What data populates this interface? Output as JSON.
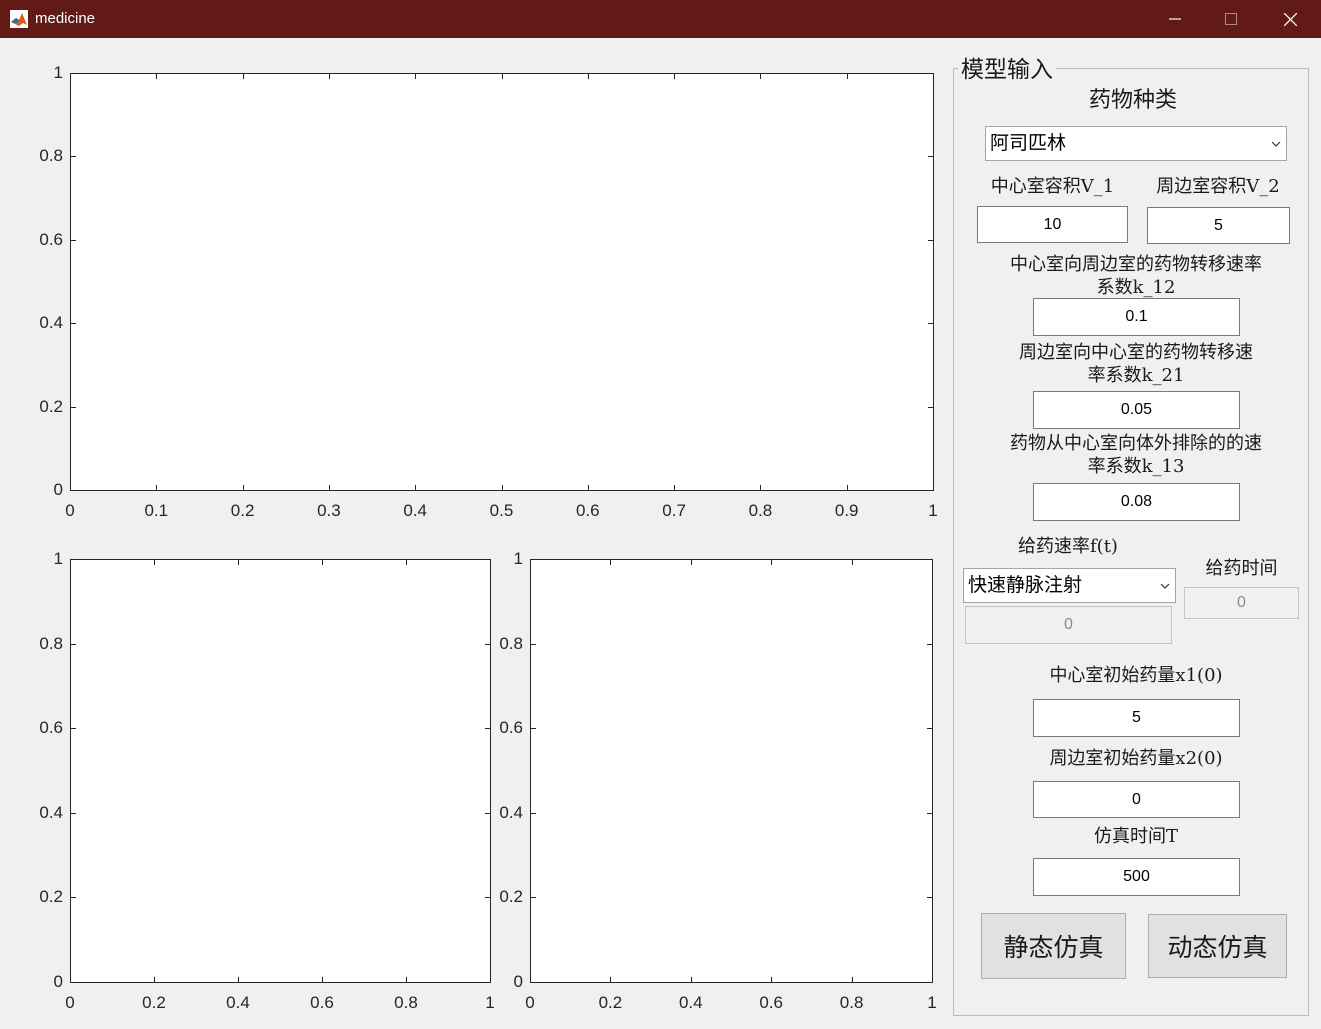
{
  "window": {
    "title": "medicine"
  },
  "plots": {
    "top": {
      "x_ticks": [
        "0",
        "0.1",
        "0.2",
        "0.3",
        "0.4",
        "0.5",
        "0.6",
        "0.7",
        "0.8",
        "0.9",
        "1"
      ],
      "y_ticks": [
        "0",
        "0.2",
        "0.4",
        "0.6",
        "0.8",
        "1"
      ]
    },
    "bottom_left": {
      "x_ticks": [
        "0",
        "0.2",
        "0.4",
        "0.6",
        "0.8",
        "1"
      ],
      "y_ticks": [
        "0",
        "0.2",
        "0.4",
        "0.6",
        "0.8",
        "1"
      ]
    },
    "bottom_right": {
      "x_ticks": [
        "0",
        "0.2",
        "0.4",
        "0.6",
        "0.8",
        "1"
      ],
      "y_ticks": [
        "0",
        "0.2",
        "0.4",
        "0.6",
        "0.8",
        "1"
      ]
    }
  },
  "panel": {
    "title": "模型输入",
    "drug_type_label": "药物种类",
    "drug_type_value": "阿司匹林",
    "v1_label": "中心室容积V_1",
    "v1_value": "10",
    "v2_label": "周边室容积V_2",
    "v2_value": "5",
    "k12_label_line1": "中心室向周边室的药物转移速率",
    "k12_label_line2": "系数k_12",
    "k12_value": "0.1",
    "k21_label_line1": "周边室向中心室的药物转移速",
    "k21_label_line2": "率系数k_21",
    "k21_value": "0.05",
    "k13_label_line1": "药物从中心室向体外排除的的速",
    "k13_label_line2": "率系数k_13",
    "k13_value": "0.08",
    "rate_label": "给药速率f(t)",
    "rate_mode_value": "快速静脉注射",
    "rate_value": "0",
    "dose_time_label": "给药时间",
    "dose_time_value": "0",
    "x1_label": "中心室初始药量x1(0)",
    "x1_value": "5",
    "x2_label": "周边室初始药量x2(0)",
    "x2_value": "0",
    "sim_time_label": "仿真时间T",
    "sim_time_value": "500",
    "static_button": "静态仿真",
    "dynamic_button": "动态仿真"
  },
  "colors": {
    "titlebar": "#611a15",
    "axes_line": "#262626",
    "background": "#f0f0f0"
  }
}
